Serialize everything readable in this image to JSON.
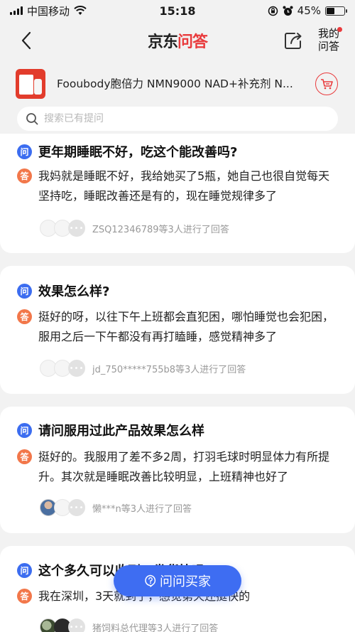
{
  "status": {
    "carrier": "中国移动",
    "time": "15:18",
    "battery": "45%",
    "battery_level": 0.45
  },
  "nav": {
    "logo_black": "京东",
    "logo_red": "问答",
    "myqa_line1": "我的",
    "myqa_line2": "问答"
  },
  "product": {
    "title": "Fooubody胞倍力 NMN9000 NAD+补充剂 N..."
  },
  "search": {
    "placeholder": "搜索已有提问"
  },
  "badges": {
    "question": "问",
    "answer": "答"
  },
  "items": [
    {
      "question": "更年期睡眠不好，吃这个能改善吗?",
      "answer": "我妈就是睡眠不好，我给她买了5瓶，她自己也很自觉每天坚持吃，睡眠改善还是有的，现在睡觉规律多了",
      "who": "ZSQ12346789等3人进行了回答"
    },
    {
      "question": "效果怎么样?",
      "answer": "挺好的呀，以往下午上班都会直犯困，哪怕睡觉也会犯困，服用之后一下午都没有再打瞌睡，感觉精神多了",
      "who": "jd_750*****755b8等3人进行了回答"
    },
    {
      "question": "请问服用过此产品效果怎么样",
      "answer": "挺好的。我服用了差不多2周，打羽毛球时明显体力有所提升。其次就是睡眠改善比较明显，上班精神也好了",
      "who": "懒***n等3人进行了回答"
    },
    {
      "question": "这个多久可以收到，发货快吗?",
      "answer": "我在深圳，3天就到了，感觉第天还挺快的",
      "who": "猪饲料总代理等3人进行了回答"
    }
  ],
  "ask_button": {
    "label": "问问买家"
  }
}
